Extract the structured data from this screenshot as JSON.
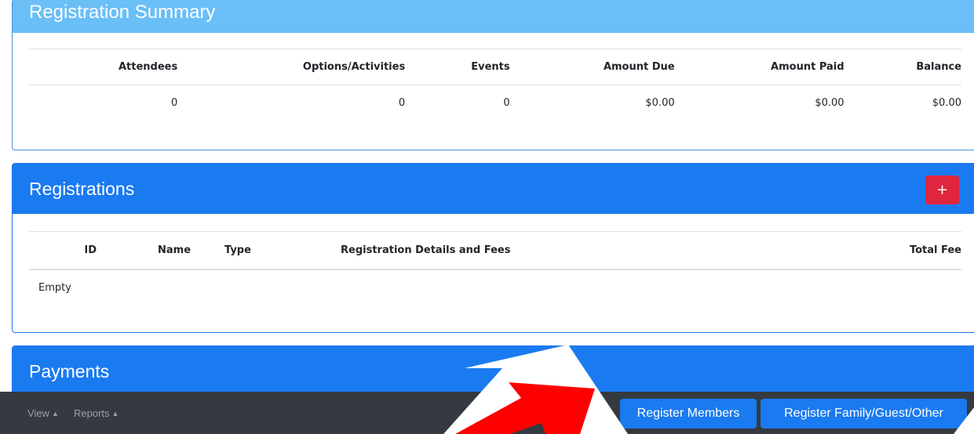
{
  "summary": {
    "title": "Registration Summary",
    "columns": [
      "Attendees",
      "Options/Activities",
      "Events",
      "Amount Due",
      "Amount Paid",
      "Balance"
    ],
    "values": [
      "0",
      "0",
      "0",
      "$0.00",
      "$0.00",
      "$0.00"
    ]
  },
  "registrations": {
    "title": "Registrations",
    "add_label": "+",
    "columns": [
      "ID",
      "Name",
      "Type",
      "Registration Details and Fees",
      "Total Fee"
    ],
    "empty_text": "Empty"
  },
  "payments": {
    "title": "Payments"
  },
  "bottombar": {
    "view_label": "View",
    "reports_label": "Reports",
    "caret": "▲",
    "register_members_label": "Register Members",
    "register_family_label": "Register Family/Guest/Other"
  },
  "colors": {
    "primary": "#1a7af0",
    "summary_header": "#6abff7",
    "danger": "#e0263e",
    "bar": "#343a40",
    "arrow": "#ff0000"
  },
  "icons": {
    "caret": "caret-up-icon",
    "pointer": "arrow-pointer-icon"
  }
}
